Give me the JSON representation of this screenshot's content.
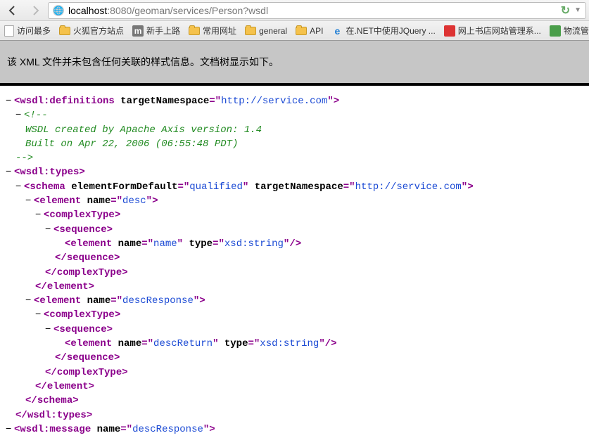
{
  "url": {
    "host": "localhost",
    "port": ":8080",
    "path": "/geoman/services/Person?wsdl"
  },
  "bookmarks": {
    "b0": "访问最多",
    "b1": "火狐官方站点",
    "b2": "新手上路",
    "b3": "常用网址",
    "b4": "general",
    "b5": "API",
    "b6": "在.NET中使用JQuery ...",
    "b7": "网上书店网站管理系...",
    "b8": "物流管理源"
  },
  "notice": "该 XML 文件并未包含任何关联的样式信息。文档树显示如下。",
  "xml": {
    "definitions_tag": "wsdl:definitions",
    "targetNamespace_attr": "targetNamespace",
    "targetNamespace_val": "http://service.com",
    "comment_open": "<!--",
    "comment_l1": "WSDL created by Apache Axis version: 1.4",
    "comment_l2": "Built on Apr 22, 2006 (06:55:48 PDT)",
    "comment_close": "-->",
    "types_tag": "wsdl:types",
    "schema_tag": "schema",
    "efd_attr": "elementFormDefault",
    "efd_val": "qualified",
    "element_tag": "element",
    "name_attr": "name",
    "type_attr": "type",
    "desc_val": "desc",
    "complexType_tag": "complexType",
    "sequence_tag": "sequence",
    "name_val": "name",
    "xsd_string": "xsd:string",
    "descResponse_val": "descResponse",
    "descReturn_val": "descReturn",
    "message_tag": "wsdl:message"
  },
  "glyph": {
    "minus": "−",
    "lt": "<",
    "gt": ">",
    "ltSlash": "</",
    "slashGt": "/>",
    "eq": "=",
    "q": "\""
  }
}
